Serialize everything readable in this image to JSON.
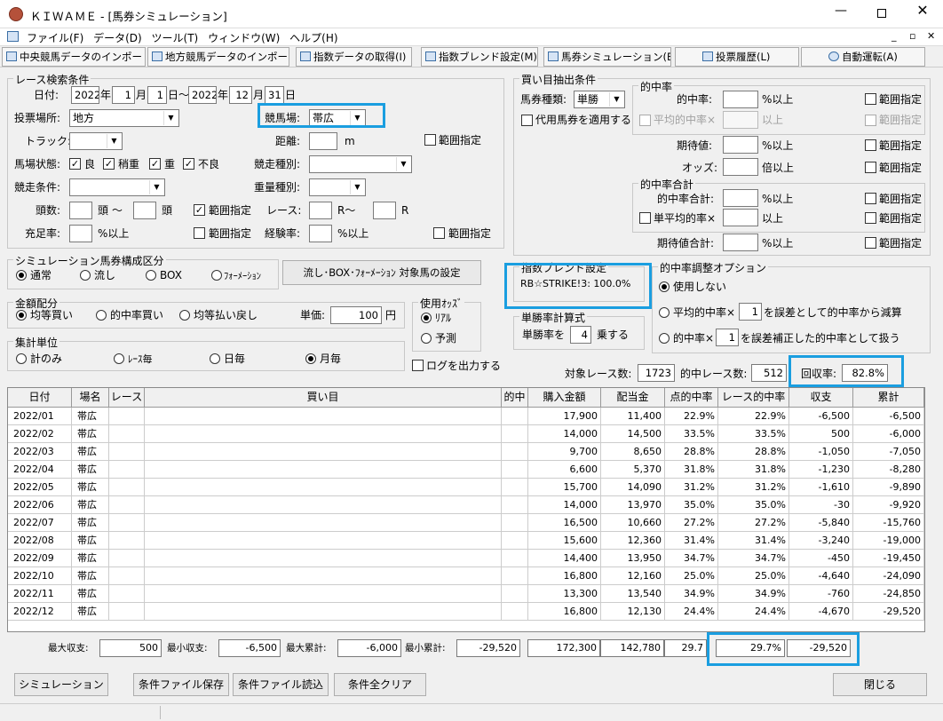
{
  "window": {
    "title": "ＫＩＷＡＭＥ - [馬券シミュレーション]"
  },
  "menu": [
    "ファイル(F)",
    "データ(D)",
    "ツール(T)",
    "ウィンドウ(W)",
    "ヘルプ(H)"
  ],
  "toolbar": [
    "中央競馬データのインポート(J)",
    "地方競馬データのインポート(N)",
    "指数データの取得(I)",
    "指数ブレンド設定(M)",
    "馬券シミュレーション(B)",
    "投票履歴(L)",
    "自動運転(A)"
  ],
  "race": {
    "group": "レース検索条件",
    "date_label": "日付:",
    "y1": "2022",
    "m1": "1",
    "d1": "1",
    "y2": "2022",
    "m2": "12",
    "d2": "31",
    "u_year": "年",
    "u_month": "月",
    "u_day": "日",
    "u_day_to": "日～",
    "venue_label": "投票場所:",
    "venue": "地方",
    "track_label": "競馬場:",
    "track": "帯広",
    "track_type_label": "トラック:",
    "distance_label": "距離:",
    "unit_m": "m",
    "range": "範囲指定",
    "cond_label": "馬場状態:",
    "conds": [
      "良",
      "稍重",
      "重",
      "不良"
    ],
    "race_type_label": "競走種別:",
    "race_cond_label": "競走条件:",
    "weight_label": "重量種別:",
    "heads_label": "頭数:",
    "head_unit": "頭",
    "tilde": "～",
    "race_label": "レース:",
    "r_unit": "R",
    "r_tilde": "R～",
    "fill_label": "充足率:",
    "pct": "%以上",
    "exp_label": "経験率:"
  },
  "sim_struct": {
    "group": "シミュレーション馬券構成区分",
    "opts": [
      "通常",
      "流し",
      "BOX",
      "ﾌｫｰﾒｰｼｮﾝ"
    ],
    "button": "流し･BOX･ﾌｫｰﾒｰｼｮﾝ 対象馬の設定"
  },
  "money": {
    "group": "金額配分",
    "opts": [
      "均等買い",
      "的中率買い",
      "均等払い戻し"
    ],
    "unit_label": "単価:",
    "unit": "100",
    "yen": "円"
  },
  "odds": {
    "group": "使用ｵｯｽﾞ",
    "opts": [
      "ﾘｱﾙ",
      "予測"
    ]
  },
  "agg": {
    "group": "集計単位",
    "opts": [
      "計のみ",
      "ﾚｰｽ毎",
      "日毎",
      "月毎"
    ],
    "log": "ログを出力する"
  },
  "blend": {
    "group": "指数ブレンド設定",
    "text": "RB☆STRIKE!3: 100.0%"
  },
  "win_rate": {
    "group": "単勝率計算式",
    "pre": "単勝率を",
    "value": "4",
    "post": "乗する"
  },
  "buy": {
    "group": "買い目抽出条件",
    "type_label": "馬券種類:",
    "type": "単勝",
    "substitute": "代用馬券を適用する",
    "hit_group": "的中率",
    "hit_label": "的中率:",
    "pct": "%以上",
    "avg_hit": "平均的中率×",
    "above": "以上",
    "range": "範囲指定",
    "ev_label": "期待値:",
    "odds_label": "オッズ:",
    "odds_unit": "倍以上",
    "sum_group": "的中率合計",
    "sum_label": "的中率合計:",
    "single_avg": "単平均的率×",
    "ev_sum": "期待値合計:"
  },
  "adjust": {
    "group": "的中率調整オプション",
    "opt1": "使用しない",
    "opt2a": "平均的中率×",
    "opt2v": "1",
    "opt2b": "を誤差として的中率から減算",
    "opt3a": "的中率×",
    "opt3v": "1",
    "opt3b": "を誤差補正した的中率として扱う"
  },
  "stats": {
    "races_label": "対象レース数:",
    "races": "1723",
    "hits_label": "的中レース数:",
    "hits": "512",
    "recovery_label": "回収率:",
    "recovery": "82.8%"
  },
  "table": {
    "headers": [
      "日付",
      "場名",
      "レース",
      "買い目",
      "的中",
      "購入金額",
      "配当金",
      "点的中率",
      "レース的中率",
      "収支",
      "累計"
    ],
    "rows": [
      [
        "2022/01",
        "帯広",
        "",
        "",
        "",
        "17,900",
        "11,400",
        "22.9%",
        "22.9%",
        "-6,500",
        "-6,500"
      ],
      [
        "2022/02",
        "帯広",
        "",
        "",
        "",
        "14,000",
        "14,500",
        "33.5%",
        "33.5%",
        "500",
        "-6,000"
      ],
      [
        "2022/03",
        "帯広",
        "",
        "",
        "",
        "9,700",
        "8,650",
        "28.8%",
        "28.8%",
        "-1,050",
        "-7,050"
      ],
      [
        "2022/04",
        "帯広",
        "",
        "",
        "",
        "6,600",
        "5,370",
        "31.8%",
        "31.8%",
        "-1,230",
        "-8,280"
      ],
      [
        "2022/05",
        "帯広",
        "",
        "",
        "",
        "15,700",
        "14,090",
        "31.2%",
        "31.2%",
        "-1,610",
        "-9,890"
      ],
      [
        "2022/06",
        "帯広",
        "",
        "",
        "",
        "14,000",
        "13,970",
        "35.0%",
        "35.0%",
        "-30",
        "-9,920"
      ],
      [
        "2022/07",
        "帯広",
        "",
        "",
        "",
        "16,500",
        "10,660",
        "27.2%",
        "27.2%",
        "-5,840",
        "-15,760"
      ],
      [
        "2022/08",
        "帯広",
        "",
        "",
        "",
        "15,600",
        "12,360",
        "31.4%",
        "31.4%",
        "-3,240",
        "-19,000"
      ],
      [
        "2022/09",
        "帯広",
        "",
        "",
        "",
        "14,400",
        "13,950",
        "34.7%",
        "34.7%",
        "-450",
        "-19,450"
      ],
      [
        "2022/10",
        "帯広",
        "",
        "",
        "",
        "16,800",
        "12,160",
        "25.0%",
        "25.0%",
        "-4,640",
        "-24,090"
      ],
      [
        "2022/11",
        "帯広",
        "",
        "",
        "",
        "13,300",
        "13,540",
        "34.9%",
        "34.9%",
        "-760",
        "-24,850"
      ],
      [
        "2022/12",
        "帯広",
        "",
        "",
        "",
        "16,800",
        "12,130",
        "24.4%",
        "24.4%",
        "-4,670",
        "-29,520"
      ]
    ]
  },
  "totals": {
    "max_label": "最大収支:",
    "max": "500",
    "min_label": "最小収支:",
    "min": "-6,500",
    "max_cum_label": "最大累計:",
    "max_cum": "-6,000",
    "min_cum_label": "最小累計:",
    "min_cum": "-29,520",
    "buy": "172,300",
    "pay": "142,780",
    "point": "29.7",
    "race_rate": "29.7%",
    "balance": "-29,520"
  },
  "buttons": {
    "simulate": "シミュレーション",
    "save": "条件ファイル保存",
    "load": "条件ファイル読込",
    "clear": "条件全クリア",
    "close": "閉じる"
  }
}
